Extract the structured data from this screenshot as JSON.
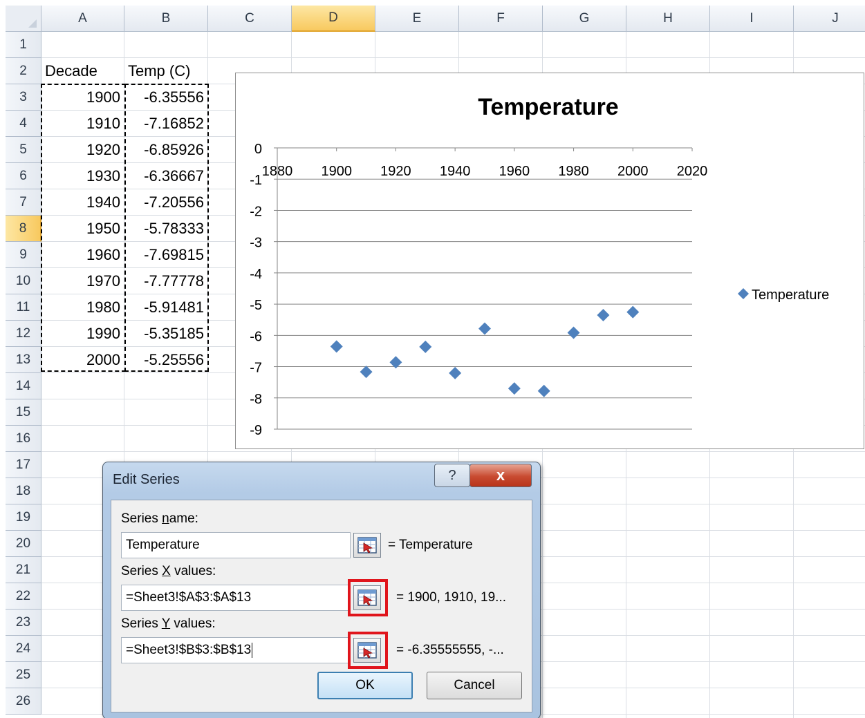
{
  "columns": [
    "A",
    "B",
    "C",
    "D",
    "E",
    "F",
    "G",
    "H",
    "I",
    "J"
  ],
  "selected_column": "D",
  "rows": [
    "1",
    "2",
    "3",
    "4",
    "5",
    "6",
    "7",
    "8",
    "9",
    "10",
    "11",
    "12",
    "13",
    "14",
    "15",
    "16",
    "17",
    "18",
    "19",
    "20",
    "21",
    "22",
    "23",
    "24",
    "25",
    "26"
  ],
  "selected_row": "8",
  "headers": {
    "a2": "Decade",
    "b2": "Temp (C)"
  },
  "table": [
    {
      "decade": "1900",
      "temp": "-6.35556"
    },
    {
      "decade": "1910",
      "temp": "-7.16852"
    },
    {
      "decade": "1920",
      "temp": "-6.85926"
    },
    {
      "decade": "1930",
      "temp": "-6.36667"
    },
    {
      "decade": "1940",
      "temp": "-7.20556"
    },
    {
      "decade": "1950",
      "temp": "-5.78333"
    },
    {
      "decade": "1960",
      "temp": "-7.69815"
    },
    {
      "decade": "1970",
      "temp": "-7.77778"
    },
    {
      "decade": "1980",
      "temp": "-5.91481"
    },
    {
      "decade": "1990",
      "temp": "-5.35185"
    },
    {
      "decade": "2000",
      "temp": "-5.25556"
    }
  ],
  "chart_data": {
    "type": "scatter",
    "title": "Temperature",
    "xlabel": "",
    "ylabel": "",
    "xlim": [
      1880,
      2020
    ],
    "ylim": [
      -9,
      0
    ],
    "x_ticks": [
      "1880",
      "1900",
      "1920",
      "1940",
      "1960",
      "1980",
      "2000",
      "2020"
    ],
    "y_ticks": [
      "0",
      "-1",
      "-2",
      "-3",
      "-4",
      "-5",
      "-6",
      "-7",
      "-8",
      "-9"
    ],
    "grid": "horizontal",
    "legend_position": "right",
    "marker": "diamond",
    "marker_color": "#4f81bd",
    "series": [
      {
        "name": "Temperature",
        "x": [
          1900,
          1910,
          1920,
          1930,
          1940,
          1950,
          1960,
          1970,
          1980,
          1990,
          2000
        ],
        "y": [
          -6.35556,
          -7.16852,
          -6.85926,
          -6.36667,
          -7.20556,
          -5.78333,
          -7.69815,
          -7.77778,
          -5.91481,
          -5.35185,
          -5.25556
        ]
      }
    ]
  },
  "dialog": {
    "title": "Edit Series",
    "help_label": "?",
    "close_label": "x",
    "series_name_label_pre": "Series ",
    "series_name_label_key": "n",
    "series_name_label_post": "ame:",
    "series_name_value": "Temperature",
    "series_name_preview": "= Temperature",
    "x_label_pre": "Series ",
    "x_label_key": "X",
    "x_label_post": " values:",
    "x_value": "=Sheet3!$A$3:$A$13",
    "x_preview": "= 1900, 1910, 19...",
    "y_label_pre": "Series ",
    "y_label_key": "Y",
    "y_label_post": " values:",
    "y_value": "=Sheet3!$B$3:$B$13",
    "y_preview": "= -6.35555555, -...",
    "ok_label": "OK",
    "cancel_label": "Cancel"
  }
}
